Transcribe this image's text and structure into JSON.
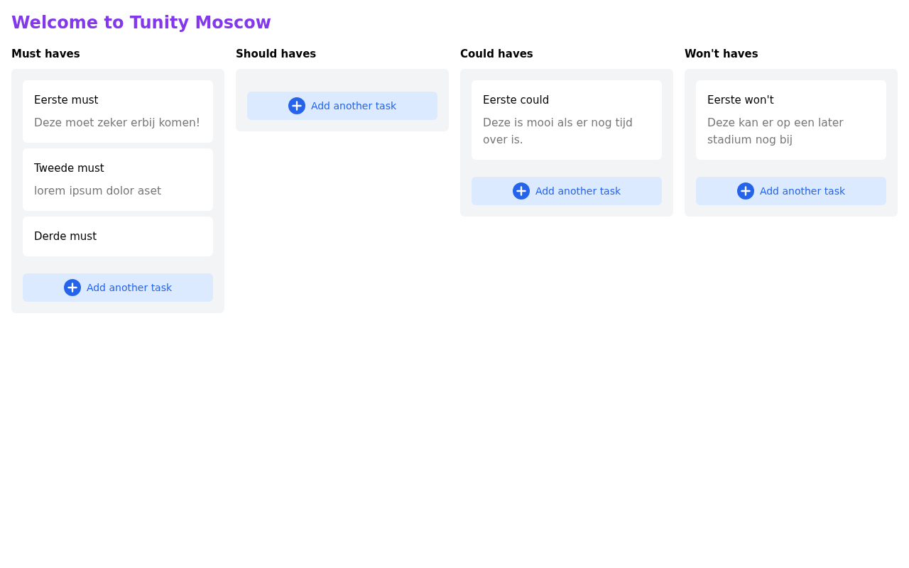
{
  "title": "Welcome to Tunity Moscow",
  "columns": [
    {
      "heading": "Must haves",
      "tasks": [
        {
          "title": "Eerste must",
          "description": "Deze moet zeker erbij komen!"
        },
        {
          "title": "Tweede must",
          "description": "lorem ipsum dolor aset"
        },
        {
          "title": "Derde must"
        }
      ],
      "add_button": "Add another task"
    },
    {
      "heading": "Should haves",
      "add_button": "Add another task"
    },
    {
      "heading": "Could haves",
      "tasks": [
        {
          "title": "Eerste could",
          "description": "Deze is mooi als er nog tijd over is."
        }
      ],
      "add_button": "Add another task"
    },
    {
      "heading": "Won't haves",
      "tasks": [
        {
          "title": "Eerste won't",
          "description": "Deze kan er op een later stadium nog bij"
        }
      ],
      "add_button": "Add another task"
    }
  ]
}
